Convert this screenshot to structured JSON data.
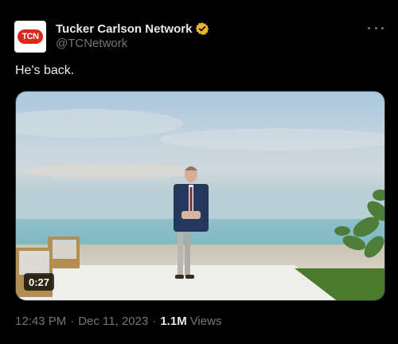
{
  "account": {
    "display_name": "Tucker Carlson Network",
    "handle": "@TCNetwork",
    "avatar_text": "TCN",
    "verified_color": "#e8b731"
  },
  "tweet": {
    "text": "He's back."
  },
  "video": {
    "duration": "0:27"
  },
  "meta": {
    "time": "12:43 PM",
    "separator": "·",
    "date": "Dec 11, 2023",
    "views_count": "1.1M",
    "views_label": "Views"
  },
  "colors": {
    "background": "#000000",
    "text_primary": "#e7e9ea",
    "text_secondary": "#71767b",
    "brand_red": "#e0261d"
  }
}
